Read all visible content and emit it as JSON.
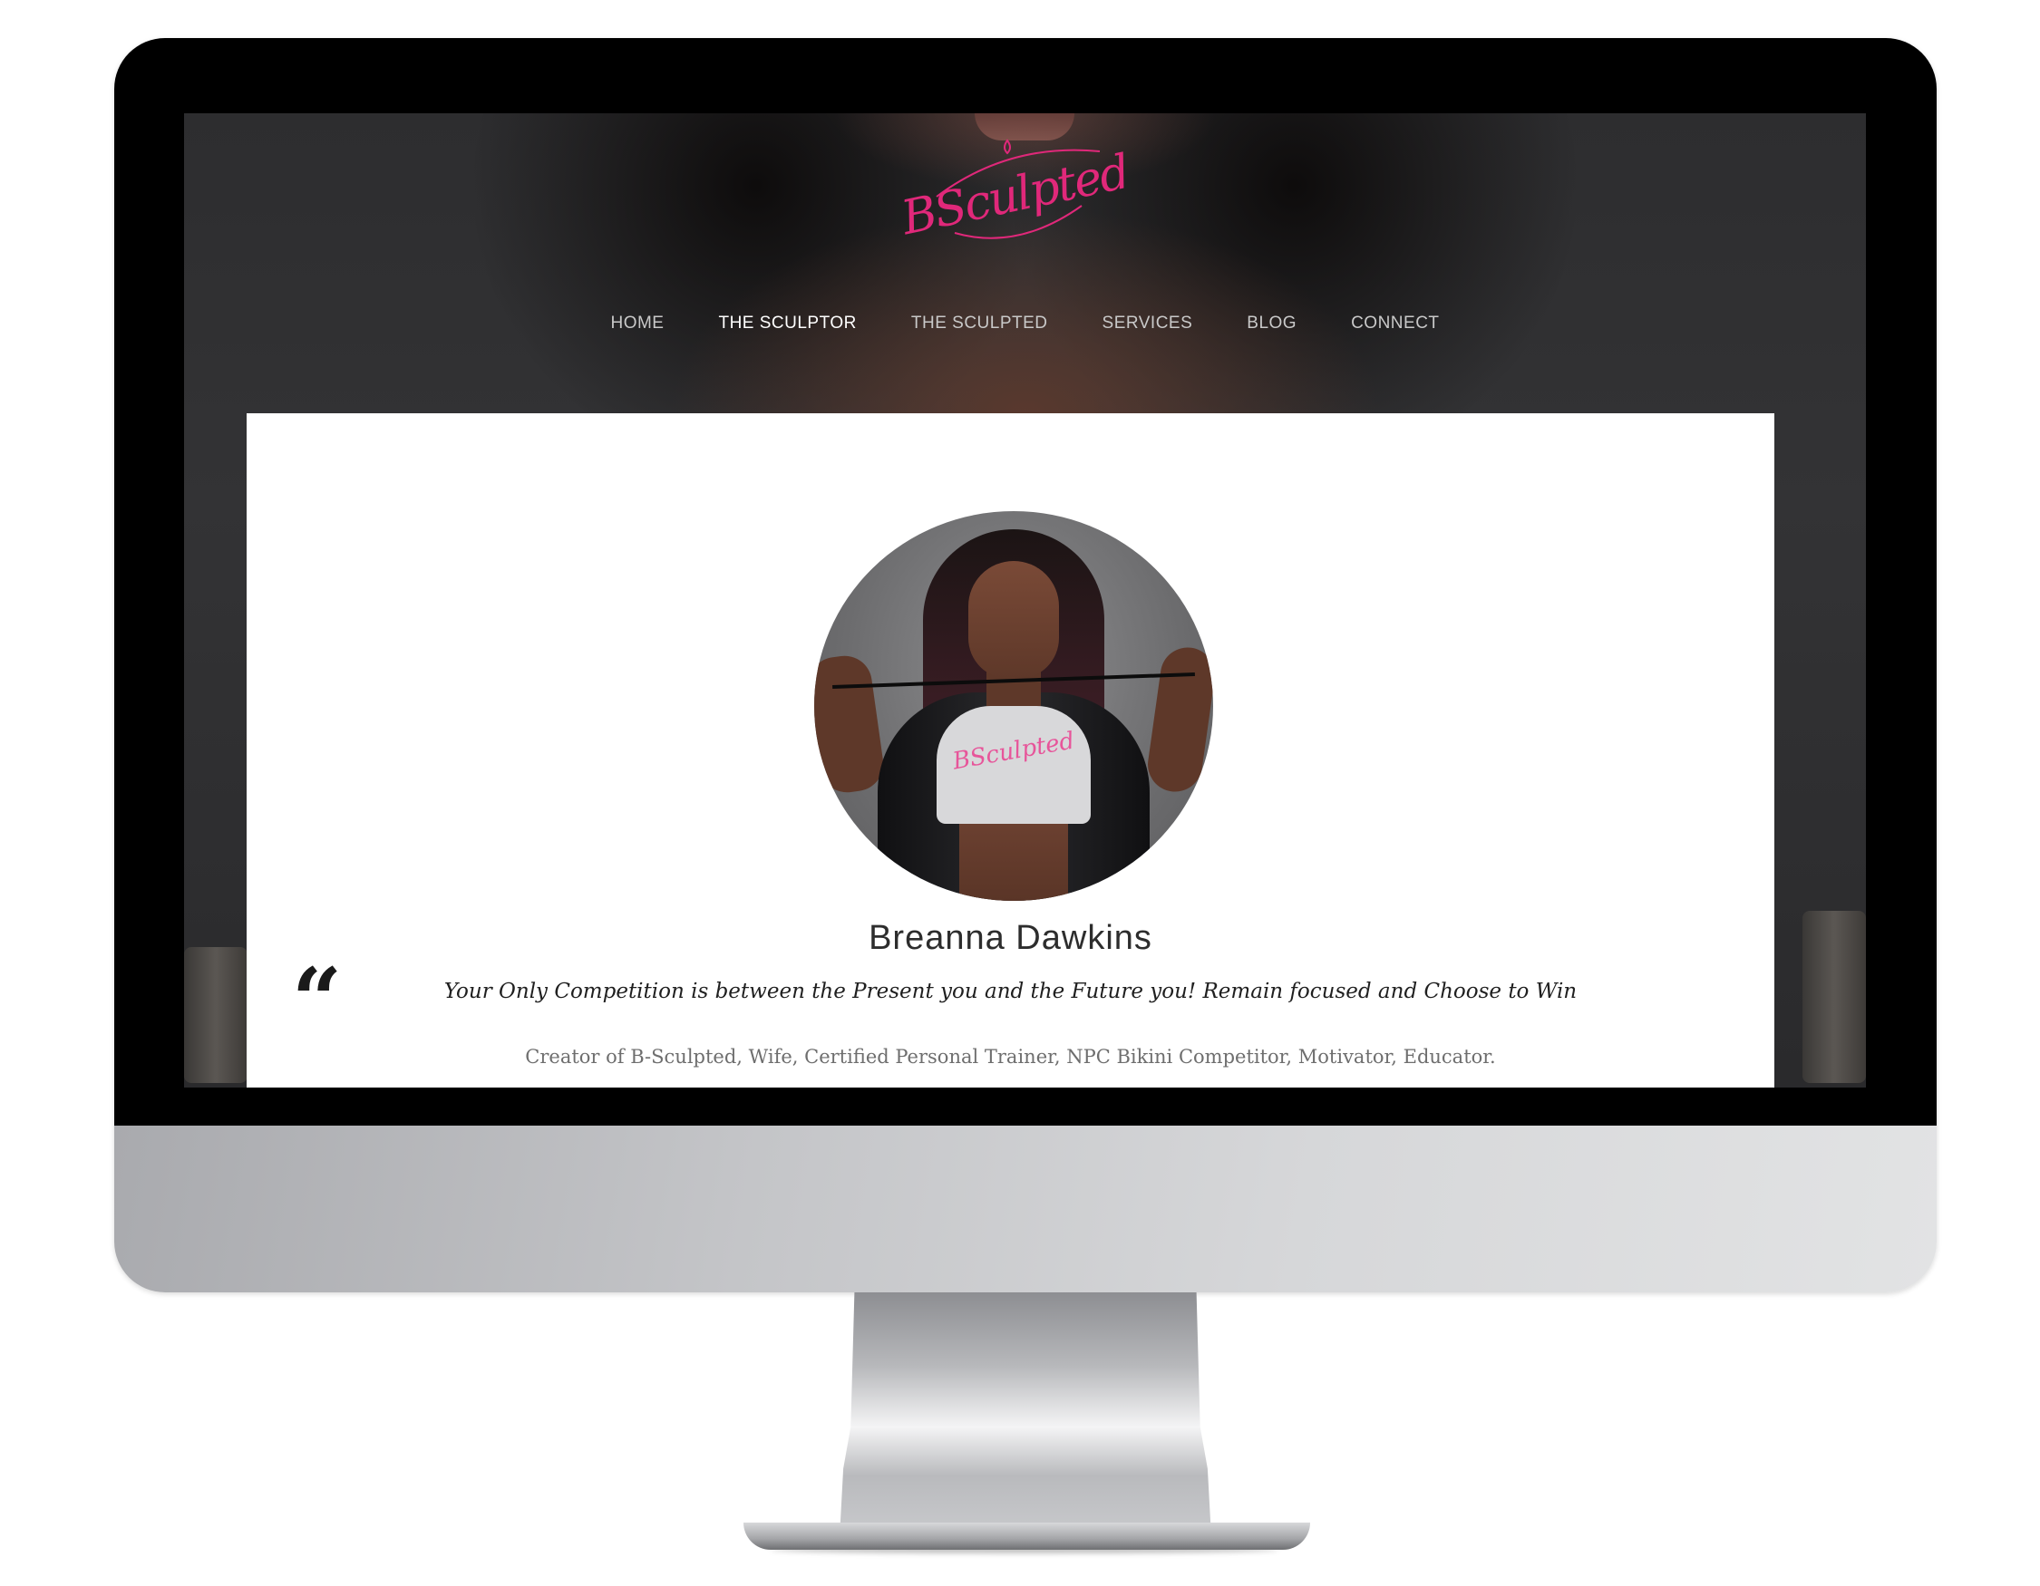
{
  "site": {
    "logo_text": "BSculpted",
    "brand_color": "#e0287a"
  },
  "nav": {
    "items": [
      {
        "label": "HOME",
        "active": false
      },
      {
        "label": "THE SCULPTOR",
        "active": true
      },
      {
        "label": "THE SCULPTED",
        "active": false
      },
      {
        "label": "SERVICES",
        "active": false
      },
      {
        "label": "BLOG",
        "active": false
      },
      {
        "label": "CONNECT",
        "active": false
      }
    ]
  },
  "profile": {
    "name": "Breanna Dawkins",
    "quote_icon": "quote-icon",
    "quote_symbol": "“",
    "quote": "Your Only Competition is between the Present you and the Future you! Remain focused and Choose to Win",
    "bio": "Creator of B-Sculpted, Wife, Certified Personal Trainer, NPC Bikini Competitor, Motivator, Educator.",
    "shirt_logo_text": "BSculpted"
  }
}
